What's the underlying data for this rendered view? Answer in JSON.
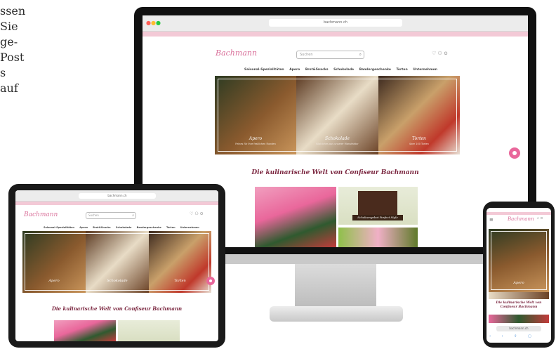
{
  "left_copy": {
    "lines": [
      "ssen",
      "Sie",
      "ge-",
      "Post",
      "s",
      "auf"
    ]
  },
  "site": {
    "logo": "Bachmann",
    "search_placeholder": "Suchen",
    "nav": [
      "Saisonal-Spezialitäten",
      "Apero",
      "Brot&Snacks",
      "Schokolade",
      "Bandergeschenke",
      "Torten",
      "Unternehmen"
    ],
    "hero": [
      {
        "title": "Apero",
        "subtitle": "Feines für Ihre festlichen Runden"
      },
      {
        "title": "Schokolade",
        "subtitle": "Köstliches aus unserer Manufaktur"
      },
      {
        "title": "Torten",
        "subtitle": "über 100 Torten"
      }
    ],
    "heading": "Die kulinarische Welt von Confiseur Bachmann",
    "heading_phone": "Die kulinarische Welt von Confiseur Bachmann",
    "tile_label": "Schokumgebot Perfect Style",
    "url": "bachmann.ch",
    "phone_url": "bachmann.ch"
  },
  "colors": {
    "accent": "#e9679b",
    "brand": "#d9709a",
    "heading": "#7b2740",
    "strip": "#f3c9d6"
  }
}
